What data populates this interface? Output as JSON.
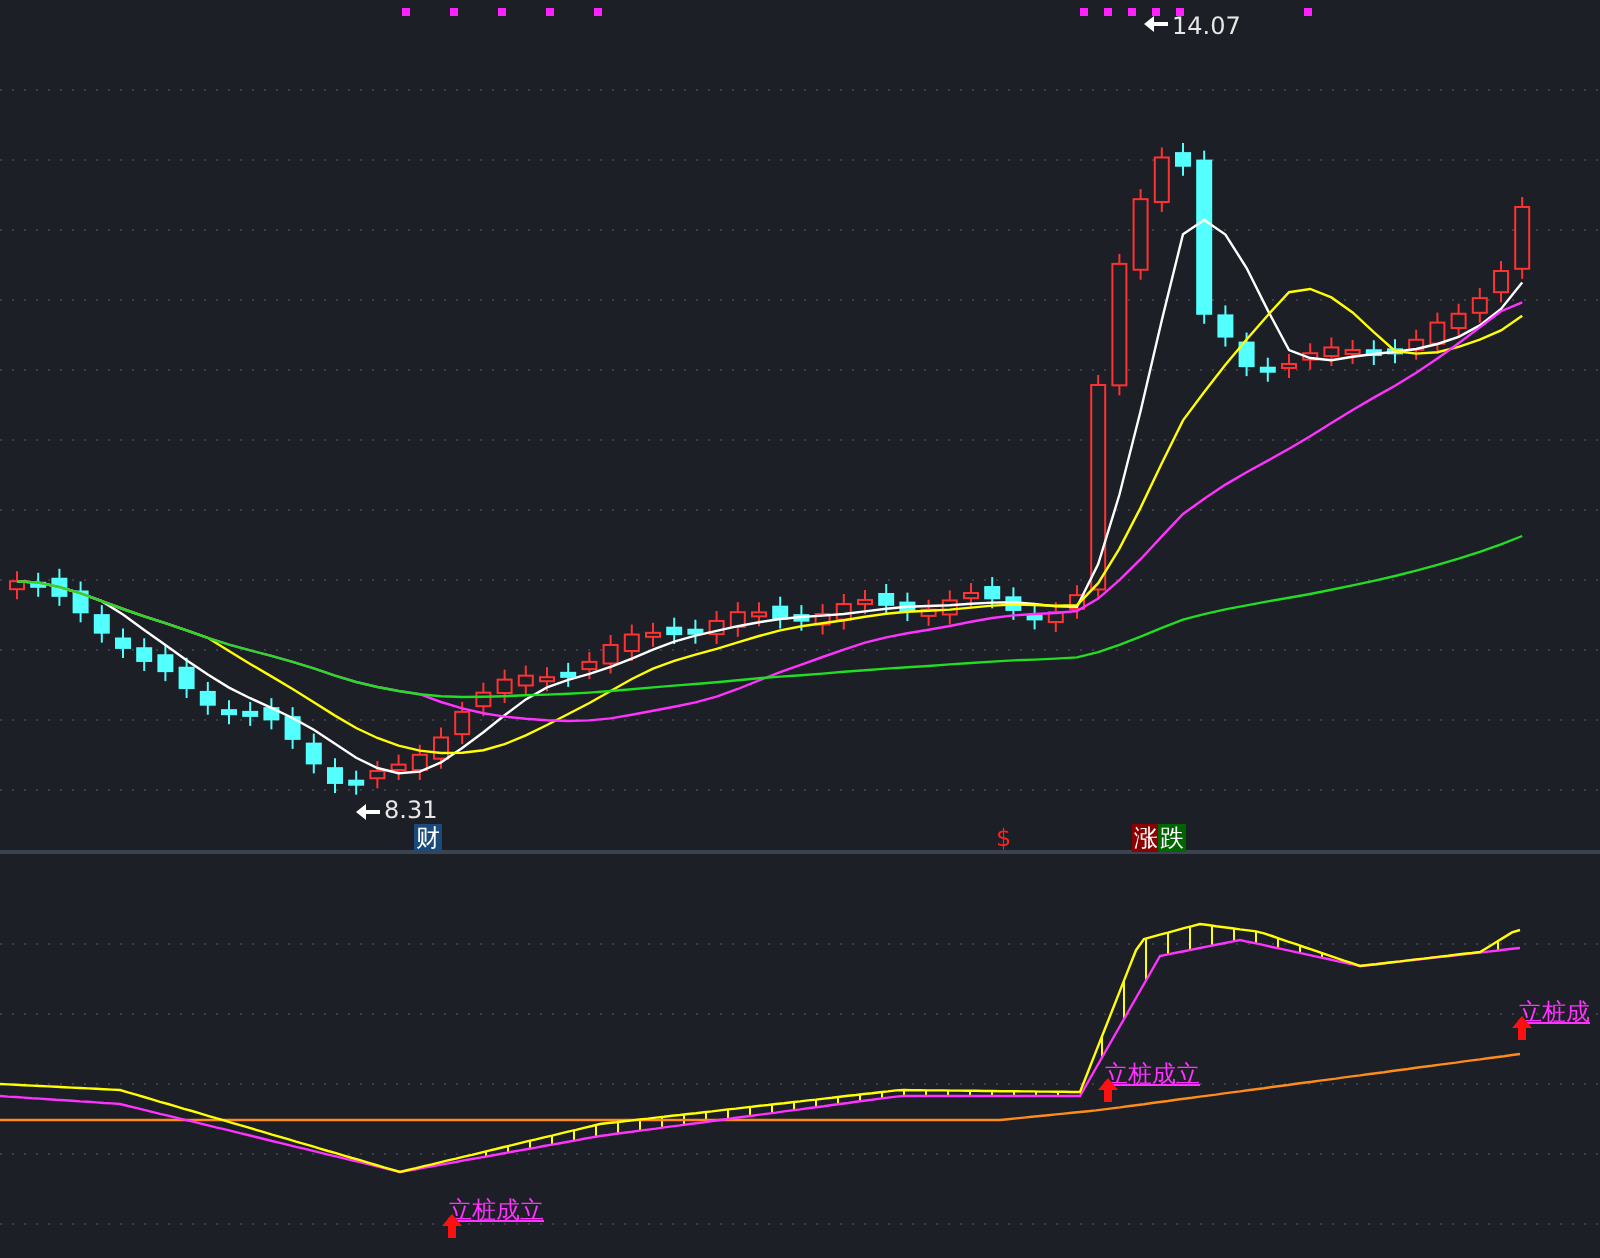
{
  "price_panel": {
    "high_label": "14.07",
    "low_label": "8.31",
    "event_markers": [
      {
        "kind": "finance",
        "text": "财"
      },
      {
        "kind": "dividend",
        "text": "$"
      },
      {
        "kind": "limit-up",
        "text": "涨"
      },
      {
        "kind": "limit-down",
        "text": "跌"
      }
    ]
  },
  "indicator_panel": {
    "signals": [
      {
        "text": "立桩成立"
      },
      {
        "text": "立桩成立"
      },
      {
        "text": "立桩成"
      }
    ]
  }
}
